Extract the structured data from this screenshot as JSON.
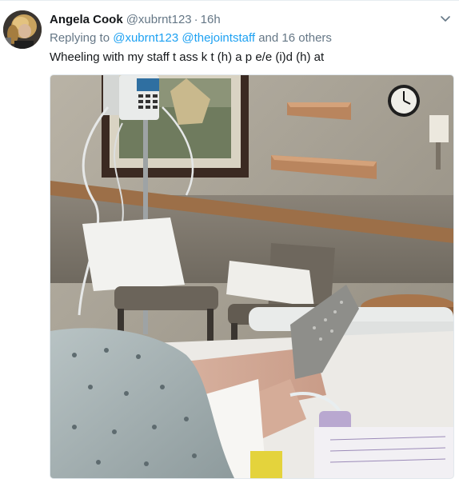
{
  "tweet": {
    "author_name": "Angela Cook",
    "author_handle": "@xubrnt123",
    "separator": "·",
    "timestamp": "16h",
    "replying_prefix": "Replying to",
    "replying_handles": [
      "@xubrnt123",
      "@thejointstaff"
    ],
    "replying_suffix": "and 16 others",
    "text": "Wheeling with my staff t ass k t (h) a p e/e (i)d (h) at"
  },
  "icons": {
    "menu": "chevron-down-icon"
  },
  "colors": {
    "link": "#1da1f2",
    "secondary_text": "#657786",
    "primary_text": "#14171a"
  }
}
